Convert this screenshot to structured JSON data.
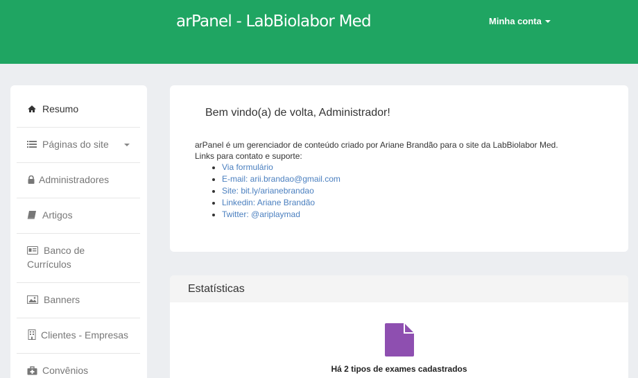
{
  "header": {
    "brand": "arPanel - LabBiolabor Med",
    "account_label": "Minha conta",
    "background_color": "#1fa562"
  },
  "sidebar": {
    "items": [
      {
        "label": "Resumo",
        "icon": "home-icon",
        "active": true
      },
      {
        "label": "Páginas do site",
        "icon": "list-icon",
        "has_submenu": true
      },
      {
        "label": "Administradores",
        "icon": "lock-icon"
      },
      {
        "label": "Artigos",
        "icon": "book-icon"
      },
      {
        "label_line1": "Banco de",
        "label_line2": "Currículos",
        "icon": "id-card-icon"
      },
      {
        "label": "Banners",
        "icon": "image-icon"
      },
      {
        "label": "Clientes - Empresas",
        "icon": "building-icon"
      },
      {
        "label": "Convênios",
        "icon": "medkit-icon"
      }
    ]
  },
  "welcome": {
    "title": "Bem vindo(a) de volta, Administrador!",
    "description": "arPanel é um gerenciador de conteúdo criado por Ariane Brandão para o site da LabBiolabor Med.",
    "links_intro": "Links para contato e suporte:",
    "links": [
      "Via formulário",
      "E-mail: arii.brandao@gmail.com",
      "Site: bit.ly/arianebrandao",
      "Linkedin: Ariane Brandão",
      "Twitter: @ariplaymad"
    ],
    "link_color": "#4a7fbf"
  },
  "stats": {
    "title": "Estatísticas",
    "icon": "document-icon",
    "icon_color": "#8e4fb0",
    "exam_types_text": "Há 2 tipos de exames cadastrados"
  }
}
